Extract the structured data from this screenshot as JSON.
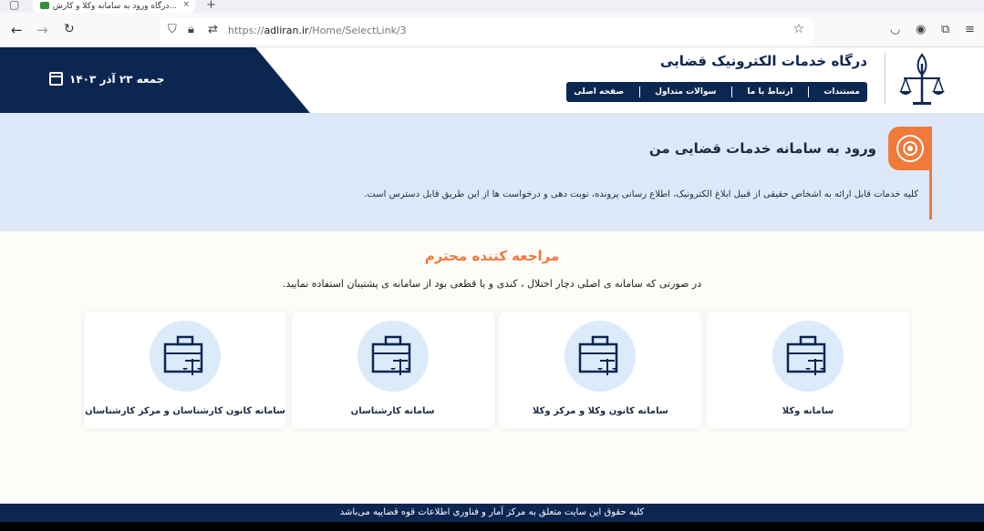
{
  "browser": {
    "tab_title": "درگاه ورود به سامانه وکلا و کارش...",
    "tab_close": "×",
    "new_tab": "+",
    "url_prefix": "https://",
    "url_host": "adliran.ir",
    "url_path": "/Home/SelectLink/3",
    "icons": [
      "back-icon",
      "forward-icon",
      "reload-icon",
      "shield-icon",
      "lock-icon",
      "permissions-icon",
      "star-icon",
      "pocket-icon",
      "account-icon",
      "extensions-icon",
      "menu-icon"
    ]
  },
  "header": {
    "title": "درگاه خدمات الکترونیک قضایی",
    "date": "جمعه ۲۳ آذر ۱۴۰۳",
    "nav": [
      "صفحه اصلی",
      "سوالات متداول",
      "ارتباط با ما",
      "مستندات"
    ]
  },
  "banner": {
    "title": "ورود به سامانه خدمات قضایی من",
    "description": "کلیه خدمات قابل ارائه به اشخاص حقیقی از قبیل ابلاغ الکترونیک، اطلاع رسانی پرونده، نوبت دهی و درخواست ها از این طریق قابل دسترس است."
  },
  "main": {
    "heading": "مراجعه کننده محترم",
    "subtext": "در صورتی که سامانه ی اصلی دچار اختلال ، کندی و یا قطعی بود از سامانه ی پشتیبان استفاده نمایید."
  },
  "cards": [
    {
      "label": "سامانه وکلا"
    },
    {
      "label": "سامانه کانون وکلا و مرکز وکلا"
    },
    {
      "label": "سامانه کارشناسان"
    },
    {
      "label": "سامانه کانون کارشناسان و مرکز کارشناسان"
    }
  ],
  "footer": {
    "text": "کلیه حقوق این سایت متعلق به مرکز آمار و فناوری اطلاعات قوه قضاییه می‌باشد"
  },
  "colors": {
    "navy": "#0c2652",
    "accent": "#f07a3a",
    "banner_bg": "#dde9f8",
    "icon_circle": "#dcebfa"
  }
}
